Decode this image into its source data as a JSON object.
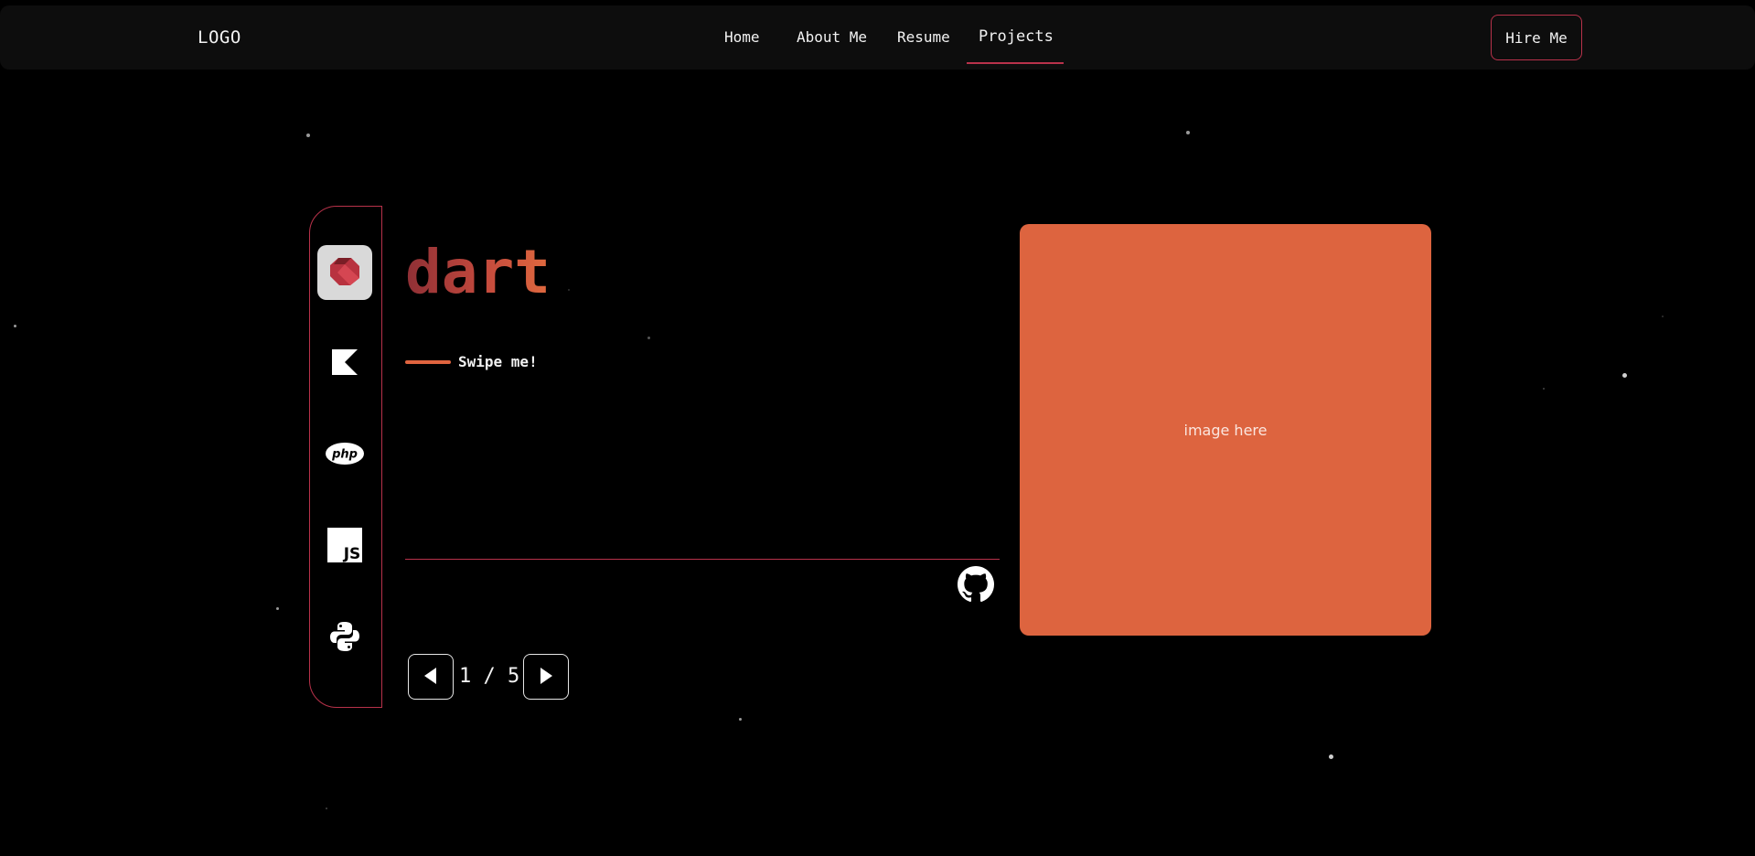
{
  "navbar": {
    "logo": "LOGO",
    "links": [
      "Home",
      "About Me",
      "Resume",
      "Projects"
    ],
    "active": "Projects",
    "hire_label": "Hire Me"
  },
  "sidebar": {
    "items": [
      {
        "name": "dart",
        "icon": "dart-icon",
        "active": true
      },
      {
        "name": "kotlin",
        "icon": "kotlin-icon",
        "active": false
      },
      {
        "name": "php",
        "icon": "php-icon",
        "active": false
      },
      {
        "name": "javascript",
        "icon": "javascript-icon",
        "active": false
      },
      {
        "name": "python",
        "icon": "python-icon",
        "active": false
      }
    ]
  },
  "project": {
    "title": "dart",
    "swipe_hint": "Swipe me!",
    "image_placeholder": "image here"
  },
  "pager": {
    "text": "1 / 5"
  },
  "colors": {
    "accent": "#b8324a",
    "orange": "#dd643f",
    "background": "#000000"
  }
}
